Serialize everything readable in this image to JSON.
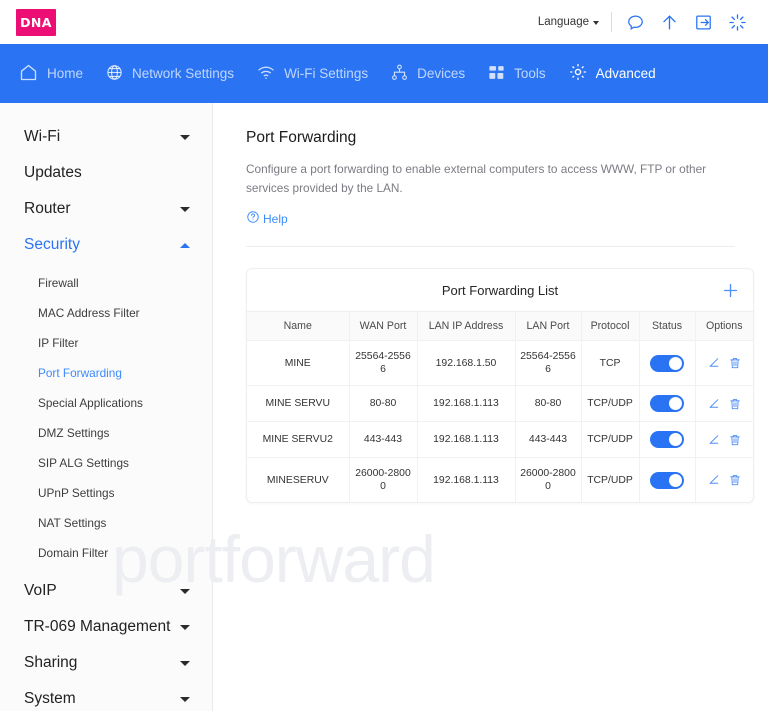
{
  "brand": {
    "logo_text": "DNA",
    "logo_color": "#ec0e74"
  },
  "accent": {
    "primary": "#2a74f4",
    "link": "#3b8bfd",
    "muted": "#7b7b83"
  },
  "topbar": {
    "language_label": "Language",
    "icons": [
      {
        "name": "chat-icon"
      },
      {
        "name": "upload-arrow-icon"
      },
      {
        "name": "logout-icon"
      },
      {
        "name": "loading-spinner-icon"
      }
    ]
  },
  "nav": {
    "items": [
      {
        "label": "Home",
        "icon": "home-icon",
        "active": false
      },
      {
        "label": "Network Settings",
        "icon": "globe-icon",
        "active": false
      },
      {
        "label": "Wi-Fi Settings",
        "icon": "wifi-icon",
        "active": false
      },
      {
        "label": "Devices",
        "icon": "devices-tree-icon",
        "active": false
      },
      {
        "label": "Tools",
        "icon": "grid-icon",
        "active": false
      },
      {
        "label": "Advanced",
        "icon": "gear-icon",
        "active": true
      }
    ]
  },
  "sidebar": {
    "groups": [
      {
        "label": "Wi-Fi",
        "chevron": "down",
        "selected": false
      },
      {
        "label": "Updates",
        "chevron": "none",
        "selected": false
      },
      {
        "label": "Router",
        "chevron": "down",
        "selected": false
      },
      {
        "label": "Security",
        "chevron": "up",
        "selected": true
      }
    ],
    "security_items": [
      {
        "label": "Firewall",
        "selected": false
      },
      {
        "label": "MAC Address Filter",
        "selected": false
      },
      {
        "label": "IP Filter",
        "selected": false
      },
      {
        "label": "Port Forwarding",
        "selected": true
      },
      {
        "label": "Special Applications",
        "selected": false
      },
      {
        "label": "DMZ Settings",
        "selected": false
      },
      {
        "label": "SIP ALG Settings",
        "selected": false
      },
      {
        "label": "UPnP Settings",
        "selected": false
      },
      {
        "label": "NAT Settings",
        "selected": false
      },
      {
        "label": "Domain Filter",
        "selected": false
      }
    ],
    "groups_bottom": [
      {
        "label": "VoIP",
        "chevron": "down",
        "selected": false
      },
      {
        "label": "TR-069 Management",
        "chevron": "down",
        "selected": false
      },
      {
        "label": "Sharing",
        "chevron": "down",
        "selected": false
      },
      {
        "label": "System",
        "chevron": "down",
        "selected": false
      }
    ]
  },
  "main": {
    "title": "Port Forwarding",
    "description": "Configure a port forwarding to enable external computers to access WWW, FTP or other services provided by the LAN.",
    "help_label": "Help",
    "card_title": "Port Forwarding List",
    "add_button_name": "add-rule-button"
  },
  "table": {
    "columns": [
      "Name",
      "WAN Port",
      "LAN IP Address",
      "LAN Port",
      "Protocol",
      "Status",
      "Options"
    ],
    "rows": [
      {
        "name": "MINE",
        "wan_port": "25564-25566",
        "lan_ip": "192.168.1.50",
        "lan_port": "25564-25566",
        "protocol": "TCP",
        "status": "on"
      },
      {
        "name": "MINE SERVU",
        "wan_port": "80-80",
        "lan_ip": "192.168.1.113",
        "lan_port": "80-80",
        "protocol": "TCP/UDP",
        "status": "on"
      },
      {
        "name": "MINE SERVU2",
        "wan_port": "443-443",
        "lan_ip": "192.168.1.113",
        "lan_port": "443-443",
        "protocol": "TCP/UDP",
        "status": "on"
      },
      {
        "name": "MINESERUV",
        "wan_port": "26000-28000",
        "lan_ip": "192.168.1.113",
        "lan_port": "26000-28000",
        "protocol": "TCP/UDP",
        "status": "on"
      }
    ]
  },
  "watermark": {
    "text": "portforward"
  }
}
